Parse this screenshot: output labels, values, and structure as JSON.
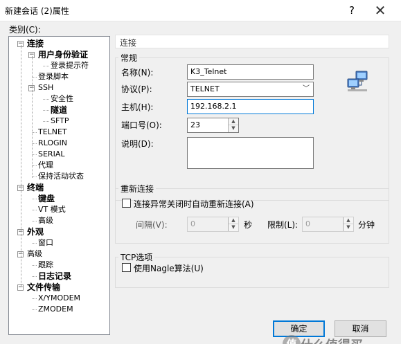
{
  "window": {
    "title": "新建会话 (2)属性",
    "help": "?",
    "close": "✕"
  },
  "category_label": "类别(C):",
  "tree": [
    {
      "label": "连接",
      "bold": true,
      "level": 0,
      "expander": "−"
    },
    {
      "label": "用户身份验证",
      "bold": true,
      "level": 1,
      "expander": "−"
    },
    {
      "label": "登录提示符",
      "bold": false,
      "level": 2
    },
    {
      "label": "登录脚本",
      "bold": false,
      "level": 1
    },
    {
      "label": "SSH",
      "bold": false,
      "level": 1,
      "expander": "−"
    },
    {
      "label": "安全性",
      "bold": false,
      "level": 2
    },
    {
      "label": "隧道",
      "bold": true,
      "level": 2
    },
    {
      "label": "SFTP",
      "bold": false,
      "level": 2
    },
    {
      "label": "TELNET",
      "bold": false,
      "level": 1
    },
    {
      "label": "RLOGIN",
      "bold": false,
      "level": 1
    },
    {
      "label": "SERIAL",
      "bold": false,
      "level": 1
    },
    {
      "label": "代理",
      "bold": false,
      "level": 1
    },
    {
      "label": "保持活动状态",
      "bold": false,
      "level": 1
    },
    {
      "label": "终端",
      "bold": true,
      "level": 0,
      "expander": "−"
    },
    {
      "label": "键盘",
      "bold": true,
      "level": 1
    },
    {
      "label": "VT 模式",
      "bold": false,
      "level": 1
    },
    {
      "label": "高级",
      "bold": false,
      "level": 1
    },
    {
      "label": "外观",
      "bold": true,
      "level": 0,
      "expander": "−"
    },
    {
      "label": "窗口",
      "bold": false,
      "level": 1
    },
    {
      "label": "高级",
      "bold": false,
      "level": 0,
      "expander": "−"
    },
    {
      "label": "跟踪",
      "bold": false,
      "level": 1
    },
    {
      "label": "日志记录",
      "bold": true,
      "level": 1
    },
    {
      "label": "文件传输",
      "bold": true,
      "level": 0,
      "expander": "−"
    },
    {
      "label": "X/YMODEM",
      "bold": false,
      "level": 1
    },
    {
      "label": "ZMODEM",
      "bold": false,
      "level": 1
    }
  ],
  "section_title": "连接",
  "general": {
    "title": "常规",
    "name_label": "名称(N):",
    "name_value": "K3_Telnet",
    "protocol_label": "协议(P):",
    "protocol_value": "TELNET",
    "host_label": "主机(H):",
    "host_value": "192.168.2.1",
    "port_label": "端口号(O):",
    "port_value": "23",
    "desc_label": "说明(D):",
    "desc_value": ""
  },
  "reconnect": {
    "title": "重新连接",
    "auto_label": "连接异常关闭时自动重新连接(A)",
    "interval_label": "间隔(V):",
    "interval_value": "0",
    "seconds_unit": "秒",
    "limit_label": "限制(L):",
    "limit_value": "0",
    "minutes_unit": "分钟"
  },
  "tcp": {
    "title": "TCP选项",
    "nagle_label": "使用Nagle算法(U)"
  },
  "buttons": {
    "ok": "确定",
    "cancel": "取消"
  },
  "watermark": {
    "logo": "值",
    "text": "什么值得买"
  }
}
